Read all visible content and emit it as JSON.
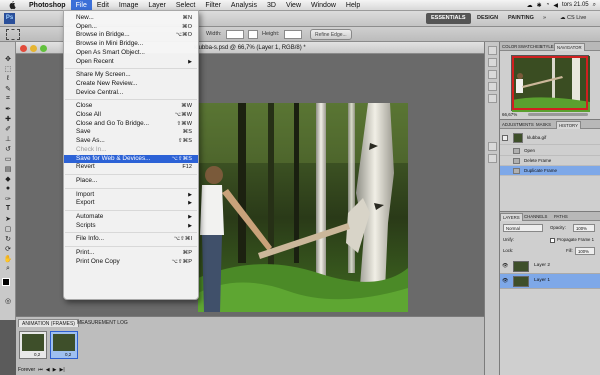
{
  "menubar": {
    "app_name": "Photoshop",
    "items": [
      "File",
      "Edit",
      "Image",
      "Layer",
      "Select",
      "Filter",
      "Analysis",
      "3D",
      "View",
      "Window",
      "Help"
    ],
    "clock": "tors 21.05"
  },
  "appbar": {
    "workspaces": [
      "ESSENTIALS",
      "DESIGN",
      "PAINTING"
    ],
    "cs_live": "CS Live"
  },
  "optbar": {
    "width_label": "Width:",
    "height_label": "Height:",
    "refine_label": "Refine Edge..."
  },
  "document": {
    "title": "klubba-s.psd @ 66,7% (Layer 1, RGB/8) *"
  },
  "file_menu": {
    "groups": [
      [
        {
          "label": "New...",
          "shortcut": "⌘N"
        },
        {
          "label": "Open...",
          "shortcut": "⌘O"
        },
        {
          "label": "Browse in Bridge...",
          "shortcut": "⌥⌘O"
        },
        {
          "label": "Browse in Mini Bridge..."
        },
        {
          "label": "Open As Smart Object..."
        },
        {
          "label": "Open Recent",
          "submenu": true
        }
      ],
      [
        {
          "label": "Share My Screen..."
        },
        {
          "label": "Create New Review..."
        },
        {
          "label": "Device Central..."
        }
      ],
      [
        {
          "label": "Close",
          "shortcut": "⌘W"
        },
        {
          "label": "Close All",
          "shortcut": "⌥⌘W"
        },
        {
          "label": "Close and Go To Bridge...",
          "shortcut": "⇧⌘W"
        },
        {
          "label": "Save",
          "shortcut": "⌘S"
        },
        {
          "label": "Save As...",
          "shortcut": "⇧⌘S"
        },
        {
          "label": "Check In...",
          "disabled": true
        },
        {
          "label": "Save for Web & Devices...",
          "shortcut": "⌥⇧⌘S",
          "highlighted": true
        },
        {
          "label": "Revert",
          "shortcut": "F12"
        }
      ],
      [
        {
          "label": "Place..."
        }
      ],
      [
        {
          "label": "Import",
          "submenu": true
        },
        {
          "label": "Export",
          "submenu": true
        }
      ],
      [
        {
          "label": "Automate",
          "submenu": true
        },
        {
          "label": "Scripts",
          "submenu": true
        }
      ],
      [
        {
          "label": "File Info...",
          "shortcut": "⌥⇧⌘I"
        }
      ],
      [
        {
          "label": "Print...",
          "shortcut": "⌘P"
        },
        {
          "label": "Print One Copy",
          "shortcut": "⌥⇧⌘P"
        }
      ]
    ]
  },
  "animation_panel": {
    "tabs": [
      "ANIMATION (FRAMES)",
      "MEASUREMENT LOG"
    ],
    "frames": [
      {
        "num": "1",
        "duration": "0,2"
      },
      {
        "num": "2",
        "duration": "0,2"
      }
    ],
    "loop": "Forever"
  },
  "navigator_panel": {
    "tabs": [
      "COLOR",
      "SWATCHES",
      "STYLES",
      "NAVIGATOR"
    ],
    "zoom": "66,67%"
  },
  "history_panel": {
    "tabs": [
      "ADJUSTMENTS",
      "MASKS",
      "HISTORY"
    ],
    "snapshot": "klubba.gif",
    "states": [
      "Open",
      "Delete Frame",
      "Duplicate Frame"
    ]
  },
  "layers_panel": {
    "tabs": [
      "LAYERS",
      "CHANNELS",
      "PATHS"
    ],
    "blend_mode": "Normal",
    "opacity_label": "Opacity:",
    "opacity": "100%",
    "unify_label": "Unify:",
    "propagate_label": "Propagate Frame 1",
    "lock_label": "Lock:",
    "fill_label": "Fill:",
    "fill": "100%",
    "layers": [
      "Layer 2",
      "Layer 1"
    ]
  }
}
